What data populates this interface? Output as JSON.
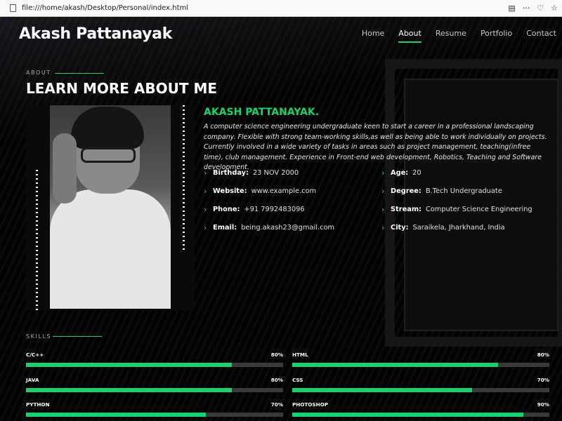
{
  "browser": {
    "url": "file:///home/akash/Desktop/Personal/index.html",
    "reader_icon": "▤",
    "more_icon": "···",
    "pocket_icon": "♡",
    "star_icon": "☆"
  },
  "header": {
    "logo": "Akash Pattanayak",
    "nav": [
      "Home",
      "About",
      "Resume",
      "Portfolio",
      "Contact"
    ],
    "active_nav": "About"
  },
  "about": {
    "label": "ABOUT",
    "title": "LEARN MORE ABOUT ME",
    "name": "AKASH PATTANAYAK.",
    "bio": "A computer science engineering undergraduate keen to start a career in a professional landscaping company. Flexible with strong team-working skills,as well as being able to work individually on projects. Currently involved in a wide variety of tasks in areas such as project management, teaching(infree time), club management. Experience in Front-end web development, Robotics, Teaching and Software development.",
    "info_left": [
      {
        "label": "Birthday:",
        "value": "23 NOV 2000"
      },
      {
        "label": "Website:",
        "value": "www.example.com"
      },
      {
        "label": "Phone:",
        "value": "+91 7992483096"
      },
      {
        "label": "Email:",
        "value": "being.akash23@gmail.com"
      }
    ],
    "info_right": [
      {
        "label": "Age:",
        "value": "20"
      },
      {
        "label": "Degree:",
        "value": "B.Tech Undergraduate"
      },
      {
        "label": "Stream:",
        "value": "Computer Science Engineering"
      },
      {
        "label": "City:",
        "value": "Saraikela, Jharkhand, India"
      }
    ],
    "chevron": "›"
  },
  "skills": {
    "label": "SKILLS",
    "items": [
      {
        "name": "C/C++",
        "percent": "80%",
        "level": 0.8
      },
      {
        "name": "HTML",
        "percent": "80%",
        "level": 0.8
      },
      {
        "name": "JAVA",
        "percent": "80%",
        "level": 0.8
      },
      {
        "name": "CSS",
        "percent": "70%",
        "level": 0.7
      },
      {
        "name": "PYTHON",
        "percent": "70%",
        "level": 0.7
      },
      {
        "name": "PHOTOSHOP",
        "percent": "90%",
        "level": 0.9
      }
    ]
  },
  "colors": {
    "accent": "#18d26e",
    "background": "#030303",
    "track": "#3a3a3a"
  }
}
